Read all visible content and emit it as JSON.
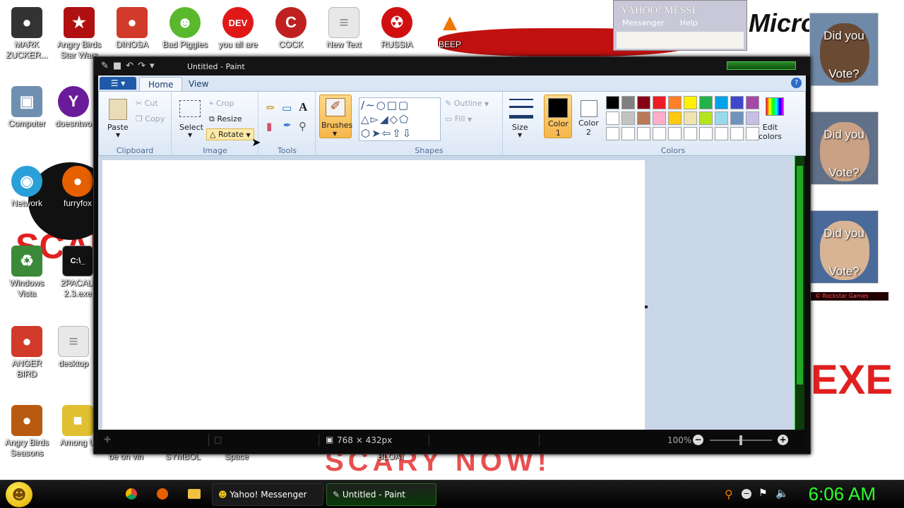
{
  "desktop": {
    "wallpaper_text": {
      "scare_top": "SCAR",
      "exe": "EXE",
      "scary_now": "SCARY NOW!",
      "micro": "Micro"
    },
    "icons": [
      {
        "label": "MARK\nZUCKER...",
        "icon": "person-icon",
        "color": "#333333"
      },
      {
        "label": "Angry Birds\nStar Wars",
        "icon": "angry-bird-starwars-icon",
        "color": "#b01010"
      },
      {
        "label": "DINOSA",
        "icon": "angry-bird-icon",
        "color": "#d23a2a"
      },
      {
        "label": "Bad Piggies",
        "icon": "pig-icon",
        "color": "#5ab82c"
      },
      {
        "label": "you all are",
        "icon": "devcpp-icon",
        "color": "#e01818"
      },
      {
        "label": "COCK",
        "icon": "ccleaner-icon",
        "color": "#c02020"
      },
      {
        "label": "New Text",
        "icon": "text-file-icon",
        "color": "#e8e8e8"
      },
      {
        "label": "RUSSIA",
        "icon": "radiation-icon",
        "color": "#d01010"
      },
      {
        "label": "BEEP",
        "icon": "vlc-icon",
        "color": "#f07800"
      },
      {
        "label": "Computer",
        "icon": "computer-icon",
        "color": "#6f8fb0"
      },
      {
        "label": "doesntwo",
        "icon": "yahoo-icon",
        "color": "#6a1b9a"
      },
      {
        "label": "Network",
        "icon": "network-icon",
        "color": "#2aa0d8"
      },
      {
        "label": "furryfox",
        "icon": "firefox-icon",
        "color": "#e66000"
      },
      {
        "label": "Windows\nVista",
        "icon": "recycle-bin-icon",
        "color": "#3a8a3a"
      },
      {
        "label": "2PACALI\n2.3.exe",
        "icon": "terminal-icon",
        "color": "#111111"
      },
      {
        "label": "ANGER\nBIRD",
        "icon": "angry-bird-icon",
        "color": "#d23a2a"
      },
      {
        "label": "desktop",
        "icon": "text-file-icon",
        "color": "#e8e8e8"
      },
      {
        "label": "Angry Birds\nSeasons",
        "icon": "angry-bird-seasons-icon",
        "color": "#b85a10"
      },
      {
        "label": "Among U",
        "icon": "among-us-icon",
        "color": "#e0c030"
      }
    ],
    "bottom_labels": [
      "be on vin",
      "SYMBOL",
      "Space",
      "BLOAT"
    ],
    "yahoo_window": {
      "title": "YAHOO! MESSE",
      "menu": [
        "Messenger",
        "Help"
      ]
    },
    "posters": [
      {
        "top": "Did you",
        "bottom": "Vote?"
      },
      {
        "top": "Did you",
        "bottom": "Vote?"
      },
      {
        "top": "Did you",
        "bottom": "Vote?"
      }
    ],
    "poster_credit": "© Rockstar Games"
  },
  "paint": {
    "title": "Untitled - Paint",
    "tabs": [
      {
        "label": "Home",
        "active": true
      },
      {
        "label": "View",
        "active": false
      }
    ],
    "clipboard": {
      "paste": "Paste",
      "cut": "Cut",
      "copy": "Copy",
      "group": "Clipboard"
    },
    "image": {
      "select": "Select",
      "crop": "Crop",
      "resize": "Resize",
      "rotate": "Rotate",
      "group": "Image"
    },
    "tools": {
      "group": "Tools"
    },
    "brushes": {
      "label": "Brushes"
    },
    "shapes": {
      "outline": "Outline",
      "fill": "Fill",
      "group": "Shapes"
    },
    "size": {
      "label": "Size"
    },
    "colors": {
      "color1": "Color\n1",
      "color2": "Color\n2",
      "edit": "Edit\ncolors",
      "group": "Colors",
      "color1_value": "#000000",
      "color2_value": "#ffffff",
      "palette_row1": [
        "#000000",
        "#7f7f7f",
        "#880015",
        "#ed1c24",
        "#ff7f27",
        "#fff200",
        "#22b14c",
        "#00a2e8",
        "#3f48cc",
        "#a349a4"
      ],
      "palette_row2": [
        "#ffffff",
        "#c3c3c3",
        "#b97a57",
        "#ffaec9",
        "#ffc90e",
        "#efe4b0",
        "#b5e61d",
        "#99d9ea",
        "#7092be",
        "#c8bfe7"
      ],
      "palette_row3": [
        "#ffffff",
        "#ffffff",
        "#ffffff",
        "#ffffff",
        "#ffffff",
        "#ffffff",
        "#ffffff",
        "#ffffff",
        "#ffffff",
        "#ffffff"
      ]
    },
    "status": {
      "dimensions": "768 × 432px",
      "zoom": "100%",
      "zoom_slider_value": 0.5
    }
  },
  "taskbar": {
    "items": [
      {
        "label": "Yahoo! Messenger",
        "icon": "yahoo-smiley-icon"
      },
      {
        "label": "Untitled - Paint",
        "icon": "paint-icon"
      }
    ],
    "clock": "6:06 AM"
  }
}
